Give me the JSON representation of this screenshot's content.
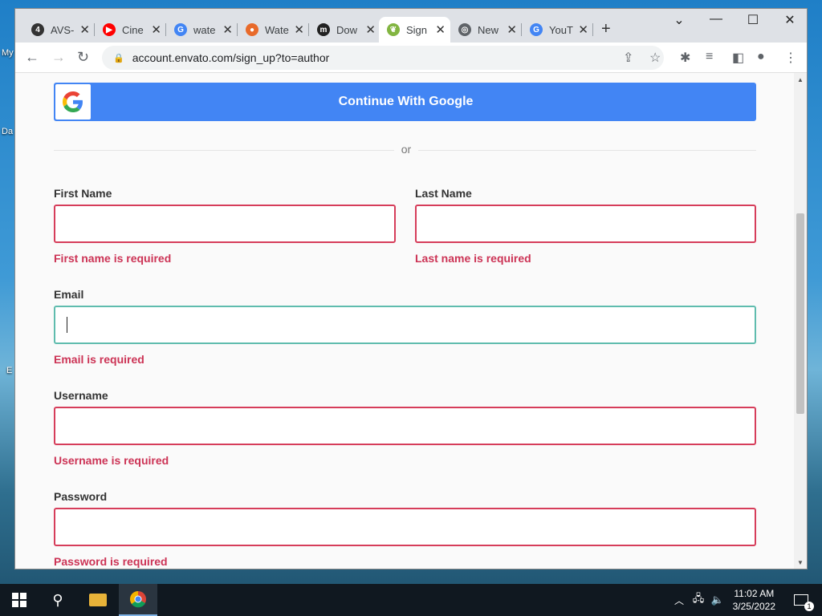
{
  "desktop": {
    "icons": [
      "My",
      "Da",
      "E"
    ]
  },
  "browser": {
    "tabs": [
      {
        "title": "AVS-",
        "fav_color": "#333333",
        "fav_glyph": "4"
      },
      {
        "title": "Cine",
        "fav_color": "#ff0000",
        "fav_glyph": "▶"
      },
      {
        "title": "wate",
        "fav_color": "#4285f4",
        "fav_glyph": "G"
      },
      {
        "title": "Wate",
        "fav_color": "#e86a2a",
        "fav_glyph": "●"
      },
      {
        "title": "Dow",
        "fav_color": "#222222",
        "fav_glyph": "m"
      },
      {
        "title": "Sign",
        "fav_color": "#82b541",
        "fav_glyph": "❦"
      },
      {
        "title": "New",
        "fav_color": "#5f6368",
        "fav_glyph": "◎"
      },
      {
        "title": "YouT",
        "fav_color": "#4285f4",
        "fav_glyph": "G"
      }
    ],
    "active_tab_index": 5,
    "url": "account.envato.com/sign_up?to=author"
  },
  "signup": {
    "google_button": "Continue With Google",
    "or_text": "or",
    "first_name": {
      "label": "First Name",
      "value": "",
      "error": "First name is required"
    },
    "last_name": {
      "label": "Last Name",
      "value": "",
      "error": "Last name is required"
    },
    "email": {
      "label": "Email",
      "value": "",
      "error": "Email is required"
    },
    "username": {
      "label": "Username",
      "value": "",
      "error": "Username is required"
    },
    "password": {
      "label": "Password",
      "value": "",
      "error": "Password is required"
    }
  },
  "colors": {
    "error": "#cc3355",
    "error_border": "#d63d5a",
    "focus_border": "#5fbcae",
    "google_blue": "#4285f4"
  },
  "taskbar": {
    "time": "11:02 AM",
    "date": "3/25/2022",
    "notification_count": "1"
  }
}
